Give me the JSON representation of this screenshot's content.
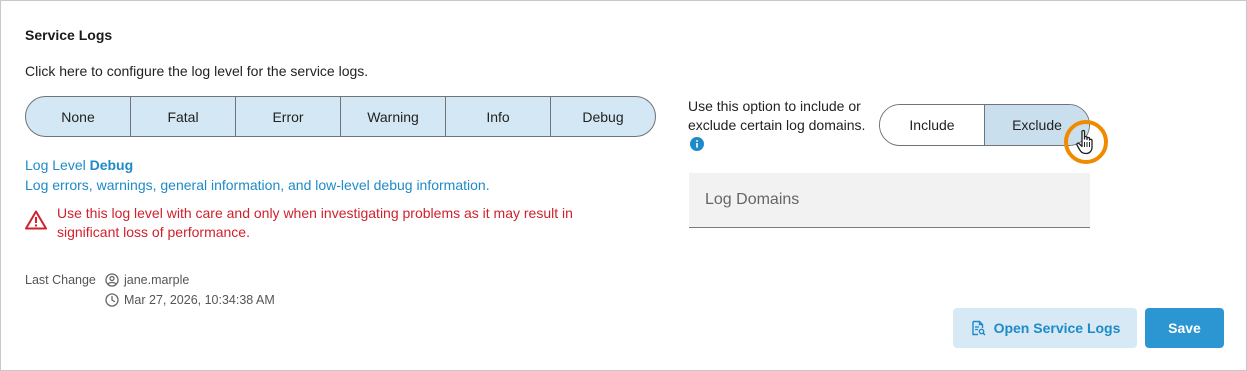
{
  "section": {
    "title": "Service Logs",
    "instruction": "Click here to configure the log level for the service logs."
  },
  "log_levels": {
    "options": [
      "None",
      "Fatal",
      "Error",
      "Warning",
      "Info",
      "Debug"
    ],
    "selected": "Debug"
  },
  "level_info": {
    "prefix": "Log Level",
    "level": "Debug",
    "description": "Log errors, warnings, general information, and low-level debug information.",
    "warning": "Use this log level with care and only when investigating problems as it may result in significant loss of performance."
  },
  "last_change": {
    "label": "Last Change",
    "user": "jane.marple",
    "timestamp": "Mar 27, 2026, 10:34:38 AM"
  },
  "domains": {
    "hint": "Use this option to include or exclude certain log domains.",
    "toggle": {
      "include_label": "Include",
      "exclude_label": "Exclude",
      "selected": "Exclude"
    },
    "field_placeholder": "Log Domains"
  },
  "actions": {
    "open_label": "Open Service Logs",
    "save_label": "Save"
  },
  "colors": {
    "accent": "#1e8ac8",
    "warning": "#d0212d",
    "segment_bg": "#d3e8f4",
    "cursor_ring": "#f08a00"
  },
  "icons": [
    "warning-icon",
    "user-icon",
    "clock-icon",
    "info-icon",
    "file-search-icon",
    "hand-cursor-icon"
  ]
}
